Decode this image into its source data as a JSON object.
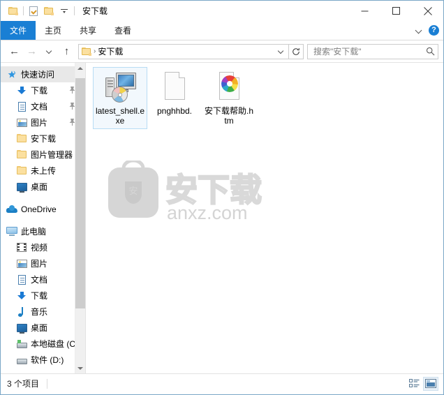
{
  "window": {
    "title": "安下载",
    "quick_access_toolbar": [
      {
        "name": "folder-properties",
        "icon": "folder-icon"
      },
      {
        "name": "properties",
        "icon": "doc-check-icon"
      },
      {
        "name": "new-folder",
        "icon": "folder-icon"
      },
      {
        "name": "customize",
        "icon": "caret-down-icon"
      }
    ],
    "controls": {
      "minimize": "minimize-icon",
      "maximize": "maximize-icon",
      "close": "close-icon"
    }
  },
  "ribbon": {
    "tabs": [
      {
        "label": "文件",
        "active": true
      },
      {
        "label": "主页",
        "active": false
      },
      {
        "label": "共享",
        "active": false
      },
      {
        "label": "查看",
        "active": false
      }
    ],
    "expand_icon": "chevron-down-icon",
    "help_label": "?"
  },
  "addressbar": {
    "back_label": "←",
    "forward_label": "→",
    "recent_icon": "chevron-down-icon",
    "up_label": "↑",
    "crumb_icon": "folder-icon",
    "crumb_sep": "›",
    "crumb_text": "安下载",
    "dropdown_icon": "chevron-down-icon",
    "refresh_icon": "refresh-icon",
    "search_placeholder": "搜索\"安下载\"",
    "search_value": "",
    "search_icon": "search-icon"
  },
  "sidebar": {
    "items": [
      {
        "label": "快速访问",
        "icon": "pin-star-icon",
        "indent": 0,
        "selected": true,
        "pinned": false
      },
      {
        "label": "下载",
        "icon": "download-icon",
        "indent": 1,
        "selected": false,
        "pinned": true
      },
      {
        "label": "文档",
        "icon": "document-icon",
        "indent": 1,
        "selected": false,
        "pinned": true
      },
      {
        "label": "图片",
        "icon": "pictures-icon",
        "indent": 1,
        "selected": false,
        "pinned": true
      },
      {
        "label": "安下载",
        "icon": "folder-icon",
        "indent": 1,
        "selected": false,
        "pinned": false
      },
      {
        "label": "图片管理器",
        "icon": "folder-icon",
        "indent": 1,
        "selected": false,
        "pinned": false
      },
      {
        "label": "未上传",
        "icon": "folder-icon",
        "indent": 1,
        "selected": false,
        "pinned": false
      },
      {
        "label": "桌面",
        "icon": "desktop-icon",
        "indent": 1,
        "selected": false,
        "pinned": false
      },
      {
        "label": "OneDrive",
        "icon": "onedrive-icon",
        "indent": 0,
        "selected": false,
        "pinned": false,
        "gap_before": true
      },
      {
        "label": "此电脑",
        "icon": "this-pc-icon",
        "indent": 0,
        "selected": false,
        "pinned": false,
        "gap_before": true
      },
      {
        "label": "视频",
        "icon": "video-icon",
        "indent": 1,
        "selected": false,
        "pinned": false
      },
      {
        "label": "图片",
        "icon": "pictures-icon",
        "indent": 1,
        "selected": false,
        "pinned": false
      },
      {
        "label": "文档",
        "icon": "document-icon",
        "indent": 1,
        "selected": false,
        "pinned": false
      },
      {
        "label": "下载",
        "icon": "download-icon",
        "indent": 1,
        "selected": false,
        "pinned": false
      },
      {
        "label": "音乐",
        "icon": "music-icon",
        "indent": 1,
        "selected": false,
        "pinned": false
      },
      {
        "label": "桌面",
        "icon": "desktop-icon",
        "indent": 1,
        "selected": false,
        "pinned": false
      },
      {
        "label": "本地磁盘 (C",
        "icon": "drive-icon",
        "indent": 1,
        "selected": false,
        "pinned": false
      },
      {
        "label": "软件 (D:)",
        "icon": "drive-plain-icon",
        "indent": 1,
        "selected": false,
        "pinned": false
      }
    ],
    "scrollbar": {
      "up_icon": "scroll-up-icon",
      "down_icon": "scroll-down-icon"
    }
  },
  "content": {
    "files": [
      {
        "name": "latest_shell.exe",
        "icon": "exe-computer-icon",
        "selected": true
      },
      {
        "name": "pnghhbd.",
        "icon": "blank-document-icon",
        "selected": false
      },
      {
        "name": "安下载帮助.htm",
        "icon": "html-pinwheel-icon",
        "selected": false
      }
    ],
    "watermark": {
      "text": "anxz.com",
      "chars": "安下载",
      "badge": "安"
    }
  },
  "statusbar": {
    "item_count": "3 个项目",
    "view_buttons": [
      {
        "name": "details-view",
        "icon": "details-view-icon",
        "active": false
      },
      {
        "name": "large-icons-view",
        "icon": "large-icons-view-icon",
        "active": true
      }
    ]
  },
  "colors": {
    "accent": "#1a7fd4",
    "selection_bg": "#f2f8fd",
    "selection_border": "#b7dcf4",
    "window_border": "#7aa7c7"
  }
}
